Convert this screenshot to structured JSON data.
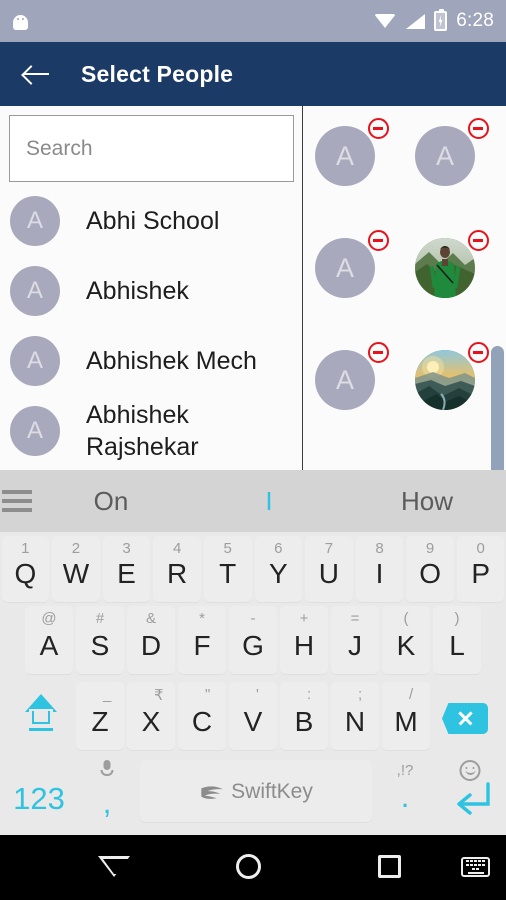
{
  "status_bar": {
    "time": "6:28",
    "icons": [
      "android-robot-icon",
      "wifi-icon",
      "signal-icon",
      "battery-charging-icon"
    ]
  },
  "app_bar": {
    "title": "Select People",
    "back_icon": "back-arrow-icon"
  },
  "search": {
    "placeholder": "Search",
    "value": ""
  },
  "contacts": [
    {
      "initial": "A",
      "name": "Abhi School"
    },
    {
      "initial": "A",
      "name": "Abhishek"
    },
    {
      "initial": "A",
      "name": "Abhishek Mech"
    },
    {
      "initial": "A",
      "name": "Abhishek Rajshekar"
    }
  ],
  "selected_people": [
    {
      "initial": "A",
      "type": "initial",
      "remove_label": "remove"
    },
    {
      "initial": "A",
      "type": "initial",
      "remove_label": "remove"
    },
    {
      "initial": "A",
      "type": "initial",
      "remove_label": "remove"
    },
    {
      "initial": "",
      "type": "photo-person-green-shirt",
      "remove_label": "remove"
    },
    {
      "initial": "A",
      "type": "initial",
      "remove_label": "remove"
    },
    {
      "initial": "",
      "type": "photo-sunset-mountains",
      "remove_label": "remove"
    }
  ],
  "keyboard": {
    "suggestions": [
      {
        "text": "On",
        "active": false
      },
      {
        "text": "I",
        "active": true
      },
      {
        "text": "How",
        "active": false
      }
    ],
    "menu_icon": "hamburger-menu-icon",
    "row1": [
      {
        "main": "Q",
        "alt": "1"
      },
      {
        "main": "W",
        "alt": "2"
      },
      {
        "main": "E",
        "alt": "3"
      },
      {
        "main": "R",
        "alt": "4"
      },
      {
        "main": "T",
        "alt": "5"
      },
      {
        "main": "Y",
        "alt": "6"
      },
      {
        "main": "U",
        "alt": "7"
      },
      {
        "main": "I",
        "alt": "8"
      },
      {
        "main": "O",
        "alt": "9"
      },
      {
        "main": "P",
        "alt": "0"
      }
    ],
    "row2": [
      {
        "main": "A",
        "alt": "@"
      },
      {
        "main": "S",
        "alt": "#"
      },
      {
        "main": "D",
        "alt": "&"
      },
      {
        "main": "F",
        "alt": "*"
      },
      {
        "main": "G",
        "alt": "-"
      },
      {
        "main": "H",
        "alt": "+"
      },
      {
        "main": "J",
        "alt": "="
      },
      {
        "main": "K",
        "alt": "("
      },
      {
        "main": "L",
        "alt": ")"
      }
    ],
    "row3": [
      {
        "main": "Z",
        "alt": "_"
      },
      {
        "main": "X",
        "alt": "₹"
      },
      {
        "main": "C",
        "alt": "\""
      },
      {
        "main": "V",
        "alt": "'"
      },
      {
        "main": "B",
        "alt": ":"
      },
      {
        "main": "N",
        "alt": ";"
      },
      {
        "main": "M",
        "alt": "/"
      }
    ],
    "shift_icon": "shift-key-icon",
    "backspace_icon": "backspace-key-icon",
    "row4": {
      "numbers_label": "123",
      "comma_label": ",",
      "comma_alt_icon": "microphone-icon",
      "space_label": "SwiftKey",
      "period_label": ".",
      "period_alt": ",!?",
      "enter_icon": "enter-key-icon",
      "enter_alt_icon": "emoji-smiley-icon"
    }
  },
  "nav_bar": {
    "back_icon": "nav-back-icon",
    "home_icon": "nav-home-icon",
    "recents_icon": "nav-recents-icon",
    "keyboard_icon": "nav-keyboard-toggle-icon"
  },
  "colors": {
    "app_bar": "#1b3a66",
    "status_bar": "#9fa5bb",
    "avatar": "#a9a9bd",
    "remove_badge": "#e8121b",
    "keyboard_accent": "#2ec3e0",
    "scrollbar": "#92a3b9"
  }
}
